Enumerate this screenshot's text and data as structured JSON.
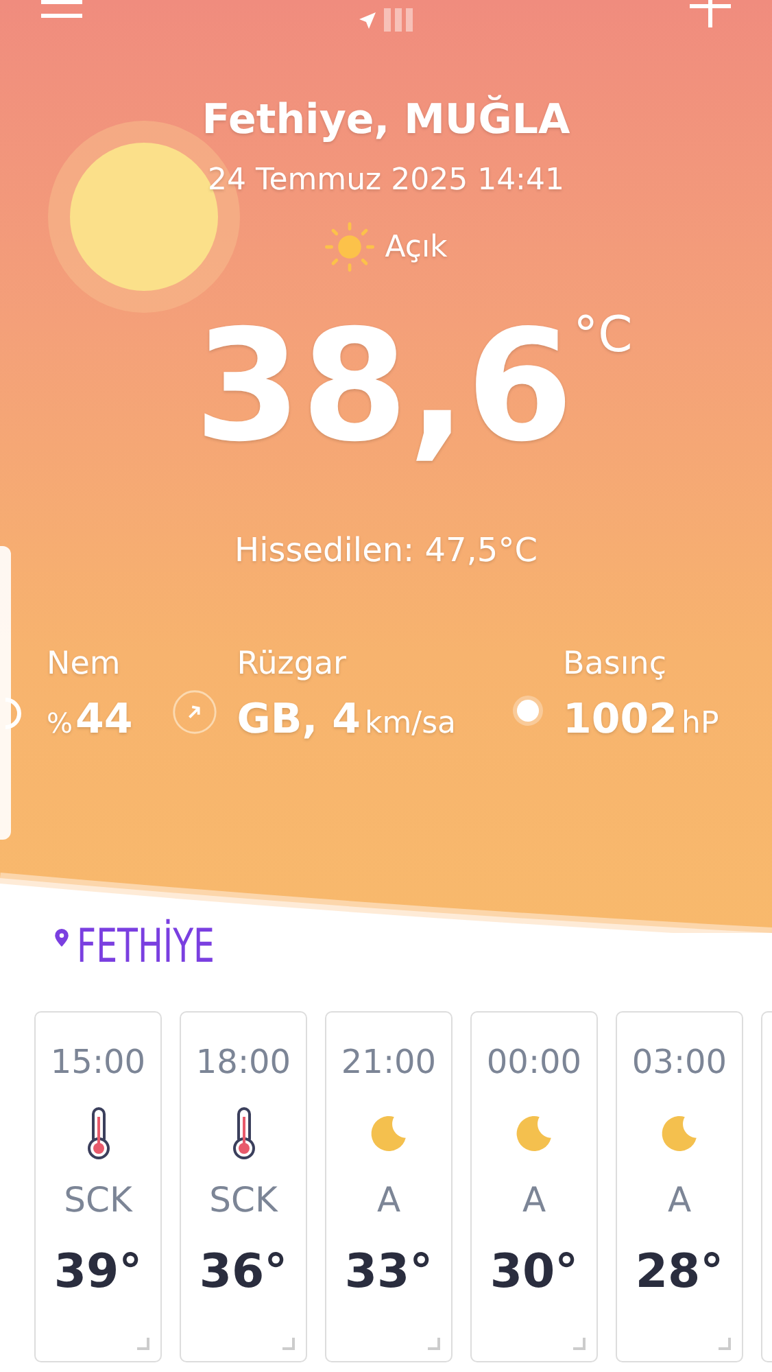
{
  "header": {
    "city": "Fethiye, MUĞLA",
    "datetime": "24 Temmuz 2025 14:41",
    "condition": "Açık",
    "temperature": "38,6",
    "unit": "°C",
    "feels_like": "Hissedilen: 47,5°C"
  },
  "pages": [
    {
      "kind": "location",
      "selected": true
    },
    {
      "kind": "bar",
      "selected": false
    },
    {
      "kind": "bar",
      "selected": false
    },
    {
      "kind": "bar",
      "selected": false
    }
  ],
  "stats": [
    {
      "kind": "humidity",
      "label": "Nem",
      "prefix": "%",
      "value": "44"
    },
    {
      "kind": "wind",
      "label": "Rüzgar",
      "value": "GB, 4",
      "unit": "km/sa"
    },
    {
      "kind": "pressure",
      "label": "Basınç",
      "value": "1002",
      "unit": "hP"
    }
  ],
  "location": "FETHİYE",
  "hourly": [
    {
      "time": "15:00",
      "kind": "hot",
      "code": "SCK",
      "temp": "39°"
    },
    {
      "time": "18:00",
      "kind": "hot",
      "code": "SCK",
      "temp": "36°"
    },
    {
      "time": "21:00",
      "kind": "night",
      "code": "A",
      "temp": "33°"
    },
    {
      "time": "00:00",
      "kind": "night",
      "code": "A",
      "temp": "30°"
    },
    {
      "time": "03:00",
      "kind": "night",
      "code": "A",
      "temp": "28°"
    }
  ]
}
